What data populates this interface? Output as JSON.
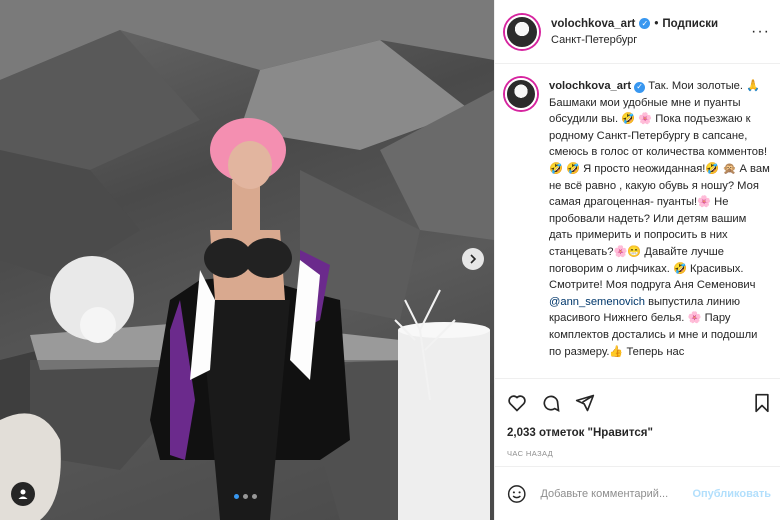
{
  "post": {
    "username": "volochkova_art",
    "follow_label": "Подписки",
    "location": "Санкт-Петербург",
    "more_icon": "more-dots-icon",
    "verified_icon": "verified-badge-icon",
    "caption": {
      "p1": "Так. Мои золотые. 🙏 Башмаки мои удобные мне и пуанты обсудили вы. 🤣 🌸 Пока подъезжаю к родному Санкт-Петербургу в сапсане, смеюсь в голос от количества комментов!🤣 🤣 Я просто неожиданная!🤣 🙊 А вам не всё равно , какую обувь я ношу? Моя самая драгоценная- пуанты!🌸 Не пробовали надеть? Или детям вашим дать примерить и попросить в них станцевать?🌸😁 Давайте лучше поговорим о лифчиках. 🤣 Красивых. Смотрите! Моя подруга Аня Семенович",
      "mention": "@ann_semenovich",
      "p2": "выпустила линию красивого Нижнего белья. 🌸 Пару комплектов достались и мне и подошли по размеру.👍 Теперь нас"
    },
    "likes_text": "2,033 отметок \"Нравится\"",
    "timestamp": "ЧАС НАЗАД",
    "comment_placeholder": "Добавьте комментарий...",
    "publish_label": "Опубликовать",
    "icons": [
      "heart-icon",
      "comment-icon",
      "share-icon",
      "bookmark-icon",
      "emoji-icon"
    ],
    "carousel": {
      "total": 3,
      "active": 1
    },
    "colors": {
      "verified": "#3897f0",
      "link": "#00376b",
      "publish_disabled": "#b2dffc",
      "hair": "#f48fb1"
    }
  }
}
